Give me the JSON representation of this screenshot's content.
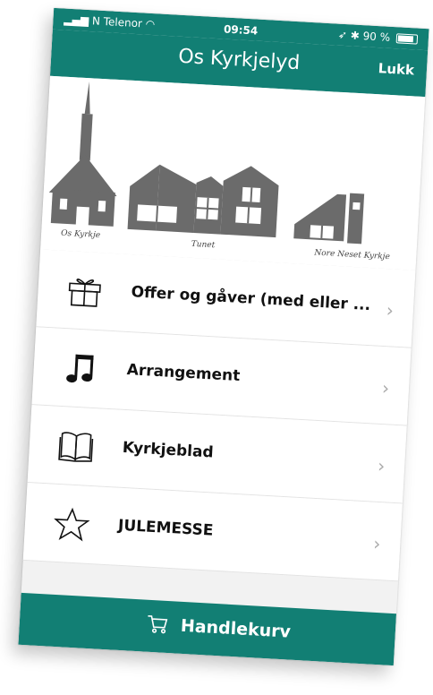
{
  "status_bar": {
    "carrier": "N Telenor",
    "time": "09:54",
    "battery": "90 %"
  },
  "header": {
    "title": "Os Kyrkjelyd",
    "close_label": "Lukk"
  },
  "hero": {
    "captions": [
      "Os Kyrkje",
      "Tunet",
      "Nore Neset Kyrkje"
    ]
  },
  "menu": {
    "items": [
      {
        "label": "Offer og gåver (med eller ...",
        "icon": "gift-icon"
      },
      {
        "label": "Arrangement",
        "icon": "music-note-icon"
      },
      {
        "label": "Kyrkjeblad",
        "icon": "open-book-icon"
      },
      {
        "label": "JULEMESSE",
        "icon": "star-icon"
      }
    ]
  },
  "footer": {
    "label": "Handlekurv",
    "icon": "shopping-cart-icon"
  },
  "colors": {
    "accent": "#127f74",
    "building": "#6b6b6b"
  }
}
